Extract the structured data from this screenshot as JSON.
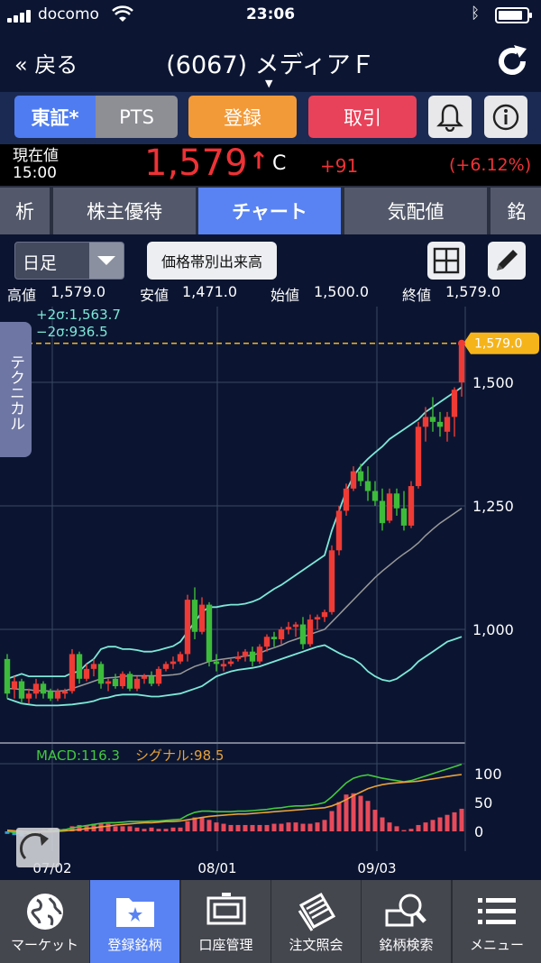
{
  "status_bar": {
    "carrier": "docomo",
    "time": "23:06"
  },
  "nav": {
    "back_label": "« 戻る",
    "title": "(6067) メディアＦ"
  },
  "buttons": {
    "market_primary": "東証*",
    "market_secondary": "PTS",
    "register": "登録",
    "trade": "取引"
  },
  "price": {
    "label_line1": "現在値",
    "label_line2": "15:00",
    "value": "1,579",
    "arrow": "↑",
    "flag": "C",
    "change": "+91",
    "change_pct": "(+6.12%)"
  },
  "tabs": [
    {
      "label": "析"
    },
    {
      "label": "株主優待"
    },
    {
      "label": "チャート",
      "active": true
    },
    {
      "label": "気配値"
    },
    {
      "label": "銘"
    }
  ],
  "controls": {
    "period_select": "日足",
    "volume_button": "価格帯別出来高"
  },
  "ohlc": {
    "high_label": "高値",
    "high": "1,579.0",
    "low_label": "安値",
    "low": "1,471.0",
    "open_label": "始値",
    "open": "1,500.0",
    "close_label": "終値",
    "close": "1,579.0"
  },
  "side_tab": "テクニカル",
  "legend": {
    "upper": "+2σ:1,563.7",
    "lower": "−2σ:936.5",
    "macd": "MACD:116.3",
    "signal": "シグナル:98.5"
  },
  "colors": {
    "up": "#ee3b35",
    "down": "#3dbb3a",
    "band": "#7ee8d8",
    "ma": "#9a9a9a",
    "macd": "#43c93f",
    "signal": "#e8a23a",
    "hist_pos": "#e84a5a",
    "hist_neg": "#3a9ad9",
    "accent": "#5983f3",
    "last_price_tag": "#f5b41a"
  },
  "chart_data": {
    "type": "candlestick",
    "y_ticks": [
      "1,500",
      "1,250",
      "1,000"
    ],
    "y_tick_values": [
      1500,
      1250,
      1000
    ],
    "last_price_tag": "1,579.0",
    "last_price_value": 1579.0,
    "x_ticks": [
      "07/02",
      "08/01",
      "09/03"
    ],
    "macd_ticks": [
      "100",
      "50",
      "0"
    ],
    "macd_tick_values": [
      100,
      50,
      0
    ],
    "candles": [
      [
        940,
        950,
        860,
        870
      ],
      [
        880,
        905,
        860,
        895
      ],
      [
        895,
        900,
        850,
        860
      ],
      [
        860,
        880,
        850,
        870
      ],
      [
        870,
        900,
        860,
        890
      ],
      [
        890,
        895,
        860,
        870
      ],
      [
        875,
        880,
        855,
        860
      ],
      [
        860,
        880,
        855,
        875
      ],
      [
        870,
        880,
        860,
        875
      ],
      [
        875,
        960,
        870,
        950
      ],
      [
        950,
        955,
        890,
        900
      ],
      [
        900,
        930,
        895,
        920
      ],
      [
        920,
        940,
        905,
        930
      ],
      [
        930,
        935,
        880,
        890
      ],
      [
        890,
        900,
        875,
        895
      ],
      [
        900,
        910,
        880,
        885
      ],
      [
        885,
        915,
        880,
        910
      ],
      [
        910,
        915,
        875,
        880
      ],
      [
        880,
        905,
        875,
        900
      ],
      [
        900,
        910,
        890,
        905
      ],
      [
        905,
        915,
        885,
        890
      ],
      [
        890,
        925,
        885,
        920
      ],
      [
        920,
        935,
        915,
        930
      ],
      [
        930,
        945,
        920,
        935
      ],
      [
        935,
        955,
        930,
        950
      ],
      [
        950,
        1070,
        935,
        1060
      ],
      [
        1060,
        1085,
        980,
        995
      ],
      [
        995,
        1065,
        990,
        1050
      ],
      [
        1050,
        1055,
        925,
        935
      ],
      [
        935,
        950,
        915,
        930
      ],
      [
        925,
        940,
        915,
        930
      ],
      [
        930,
        940,
        925,
        935
      ],
      [
        940,
        955,
        935,
        945
      ],
      [
        945,
        960,
        935,
        955
      ],
      [
        955,
        965,
        925,
        935
      ],
      [
        935,
        970,
        930,
        965
      ],
      [
        965,
        990,
        955,
        985
      ],
      [
        985,
        995,
        965,
        980
      ],
      [
        980,
        1005,
        970,
        1000
      ],
      [
        1000,
        1015,
        990,
        1005
      ],
      [
        1005,
        1015,
        985,
        1010
      ],
      [
        1010,
        1025,
        960,
        970
      ],
      [
        970,
        1030,
        965,
        1020
      ],
      [
        1020,
        1030,
        1000,
        1025
      ],
      [
        1025,
        1040,
        1015,
        1035
      ],
      [
        1035,
        1170,
        1030,
        1160
      ],
      [
        1160,
        1250,
        1150,
        1240
      ],
      [
        1240,
        1295,
        1230,
        1285
      ],
      [
        1285,
        1330,
        1280,
        1320
      ],
      [
        1320,
        1335,
        1290,
        1300
      ],
      [
        1300,
        1330,
        1260,
        1280
      ],
      [
        1280,
        1300,
        1250,
        1260
      ],
      [
        1260,
        1285,
        1200,
        1215
      ],
      [
        1220,
        1285,
        1215,
        1275
      ],
      [
        1275,
        1285,
        1230,
        1245
      ],
      [
        1245,
        1280,
        1200,
        1210
      ],
      [
        1210,
        1300,
        1205,
        1290
      ],
      [
        1290,
        1420,
        1285,
        1410
      ],
      [
        1410,
        1450,
        1380,
        1430
      ],
      [
        1430,
        1470,
        1400,
        1420
      ],
      [
        1420,
        1440,
        1390,
        1410
      ],
      [
        1400,
        1440,
        1380,
        1430
      ],
      [
        1430,
        1490,
        1390,
        1485
      ],
      [
        1500,
        1579,
        1471,
        1579
      ]
    ],
    "bands": {
      "upper": [
        900,
        905,
        910,
        905,
        905,
        905,
        905,
        905,
        905,
        912,
        915,
        930,
        940,
        960,
        965,
        965,
        960,
        960,
        958,
        955,
        955,
        958,
        962,
        966,
        975,
        995,
        1015,
        1035,
        1045,
        1045,
        1048,
        1050,
        1050,
        1052,
        1056,
        1062,
        1072,
        1082,
        1090,
        1100,
        1110,
        1120,
        1130,
        1140,
        1150,
        1200,
        1240,
        1280,
        1310,
        1330,
        1345,
        1358,
        1370,
        1385,
        1395,
        1405,
        1415,
        1425,
        1440,
        1450,
        1460,
        1470,
        1480,
        1490
      ],
      "ma": [
        880,
        880,
        878,
        878,
        876,
        876,
        875,
        875,
        876,
        880,
        885,
        890,
        895,
        900,
        902,
        903,
        905,
        906,
        906,
        906,
        906,
        906,
        907,
        908,
        910,
        918,
        925,
        930,
        935,
        938,
        940,
        942,
        944,
        946,
        948,
        952,
        958,
        963,
        968,
        975,
        980,
        985,
        990,
        995,
        1000,
        1015,
        1030,
        1045,
        1060,
        1075,
        1090,
        1105,
        1118,
        1130,
        1142,
        1153,
        1163,
        1175,
        1190,
        1203,
        1215,
        1225,
        1235,
        1245
      ],
      "lower": [
        860,
        855,
        850,
        848,
        846,
        846,
        846,
        846,
        847,
        848,
        850,
        852,
        855,
        860,
        862,
        866,
        868,
        868,
        868,
        866,
        864,
        864,
        866,
        868,
        870,
        875,
        880,
        885,
        895,
        905,
        910,
        915,
        918,
        920,
        922,
        925,
        930,
        935,
        940,
        945,
        950,
        955,
        960,
        965,
        968,
        960,
        952,
        945,
        940,
        930,
        915,
        905,
        898,
        895,
        900,
        910,
        920,
        935,
        945,
        955,
        965,
        975,
        980,
        985
      ]
    },
    "macd": [
      0,
      -2,
      -4,
      -3,
      -1,
      0,
      1,
      2,
      3,
      6,
      8,
      10,
      12,
      14,
      15,
      15,
      16,
      17,
      17,
      17,
      18,
      18,
      19,
      20,
      21,
      28,
      33,
      35,
      35,
      34,
      34,
      34,
      35,
      35,
      36,
      37,
      38,
      40,
      41,
      43,
      44,
      44,
      45,
      47,
      50,
      60,
      72,
      84,
      92,
      96,
      98,
      95,
      92,
      90,
      88,
      86,
      88,
      92,
      96,
      100,
      104,
      108,
      112,
      116.3
    ],
    "signal": [
      2,
      1,
      0,
      -1,
      -1,
      -1,
      -1,
      0,
      1,
      2,
      3,
      5,
      6,
      8,
      9,
      11,
      12,
      13,
      14,
      15,
      15,
      16,
      17,
      17,
      18,
      20,
      22,
      24,
      26,
      27,
      28,
      29,
      30,
      30,
      31,
      32,
      33,
      34,
      35,
      36,
      37,
      38,
      39,
      40,
      41,
      44,
      49,
      55,
      62,
      68,
      74,
      78,
      81,
      83,
      84,
      85,
      86,
      87,
      89,
      91,
      93,
      95,
      97,
      98.5
    ]
  },
  "footer": [
    {
      "label": "マーケット",
      "icon": "globe-icon"
    },
    {
      "label": "登録銘柄",
      "icon": "folder-star-icon",
      "active": true
    },
    {
      "label": "口座管理",
      "icon": "account-icon"
    },
    {
      "label": "注文照会",
      "icon": "document-icon"
    },
    {
      "label": "銘柄検索",
      "icon": "search-icon"
    },
    {
      "label": "メニュー",
      "icon": "menu-icon"
    }
  ]
}
